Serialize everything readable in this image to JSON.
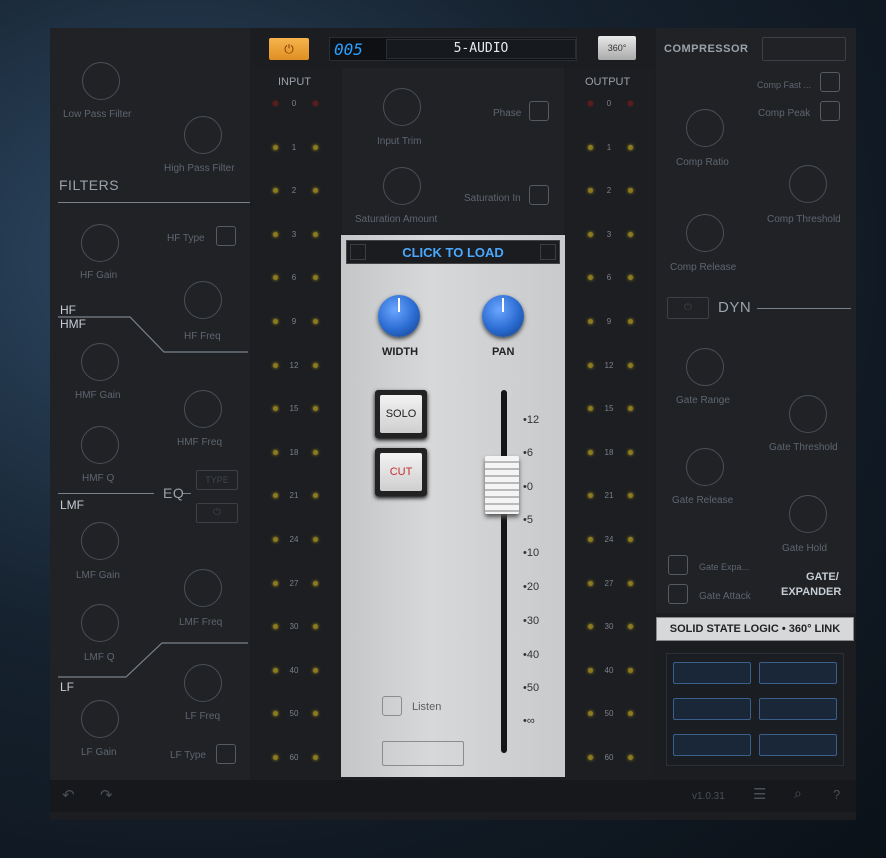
{
  "topbar": {
    "track_number": "005",
    "track_name": "5-AUDIO",
    "view_label": "360°"
  },
  "filters": {
    "section_label": "FILTERS",
    "low_pass": "Low Pass Filter",
    "high_pass": "High Pass Filter"
  },
  "eq": {
    "section_label": "EQ",
    "hf_label": "HF",
    "hmf_label": "HMF",
    "lmf_label": "LMF",
    "lf_label": "LF",
    "hf_type": "HF Type",
    "hf_gain": "HF Gain",
    "hf_freq": "HF Freq",
    "hmf_gain": "HMF Gain",
    "hmf_freq": "HMF Freq",
    "hmf_q": "HMF Q",
    "type_btn": "TYPE",
    "lmf_gain": "LMF Gain",
    "lmf_freq": "LMF Freq",
    "lmf_q": "LMF Q",
    "lf_freq": "LF Freq",
    "lf_gain": "LF Gain",
    "lf_type": "LF Type"
  },
  "meters": {
    "input_label": "INPUT",
    "output_label": "OUTPUT",
    "scale": [
      "0",
      "1",
      "2",
      "3",
      "6",
      "9",
      "12",
      "15",
      "18",
      "21",
      "24",
      "27",
      "30",
      "40",
      "50",
      "60"
    ]
  },
  "center": {
    "input_trim": "Input Trim",
    "phase": "Phase",
    "saturation_amount": "Saturation Amount",
    "saturation_in": "Saturation In",
    "preset_label": "CLICK TO LOAD",
    "width_label": "WIDTH",
    "pan_label": "PAN",
    "solo_label": "SOLO",
    "cut_label": "CUT",
    "listen_label": "Listen",
    "fader_scale": [
      "12",
      "6",
      "0",
      "5",
      "10",
      "20",
      "30",
      "40",
      "50",
      "∞"
    ]
  },
  "dynamics": {
    "compressor_label": "COMPRESSOR",
    "comp_fast": "Comp Fast ...",
    "comp_peak": "Comp Peak",
    "comp_ratio": "Comp Ratio",
    "comp_threshold": "Comp Threshold",
    "comp_release": "Comp Release",
    "dyn_label": "DYN",
    "gate_range": "Gate Range",
    "gate_threshold": "Gate Threshold",
    "gate_release": "Gate Release",
    "gate_hold": "Gate Hold",
    "gate_expa": "Gate Expa...",
    "gate_attack": "Gate Attack",
    "gate_section_line1": "GATE/",
    "gate_section_line2": "EXPANDER"
  },
  "brand": {
    "logo_text": "SOLID STATE LOGIC • 360° LINK"
  },
  "footer": {
    "version": "v1.0.31"
  },
  "colors": {
    "accent_blue": "#2a6bd1",
    "power_orange": "#f2a23a",
    "track_cyan": "#2aa0ff"
  }
}
